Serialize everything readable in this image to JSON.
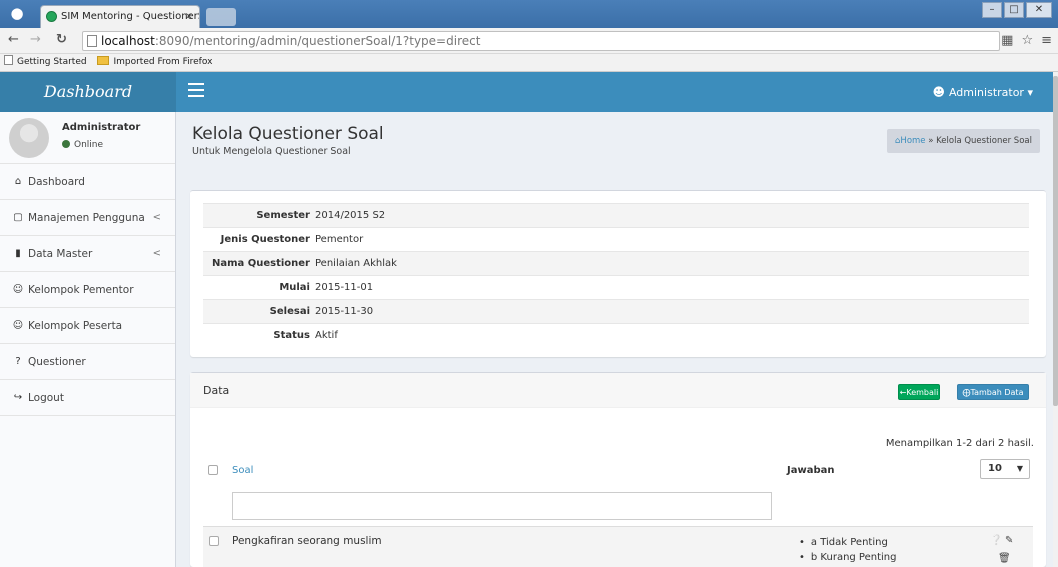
{
  "browser": {
    "tab_title": "SIM Mentoring - QuestionerS",
    "url_host": "localhost",
    "url_path": ":8090/mentoring/admin/questionerSoal/1?type=direct",
    "bookmarks": [
      "Getting Started",
      "Imported From Firefox"
    ],
    "close_glyph": "×"
  },
  "header": {
    "logo": "Dashboard",
    "user_menu": "Administrator"
  },
  "sidebar": {
    "user_name": "Administrator",
    "status": "Online",
    "items": [
      {
        "label": "Dashboard",
        "icon": "home-icon"
      },
      {
        "label": "Manajemen Pengguna",
        "icon": "lock-icon"
      },
      {
        "label": "Data Master",
        "icon": "book-icon"
      },
      {
        "label": "Kelompok Pementor",
        "icon": "users-icon"
      },
      {
        "label": "Kelompok Peserta",
        "icon": "users-icon"
      },
      {
        "label": "Questioner",
        "icon": "question-icon"
      },
      {
        "label": "Logout",
        "icon": "logout-icon"
      }
    ]
  },
  "page": {
    "title": "Kelola Questioner Soal",
    "subtitle": "Untuk Mengelola Questioner Soal",
    "breadcrumb_home": "Home",
    "breadcrumb_sep": " » ",
    "breadcrumb_current": "Kelola Questioner Soal"
  },
  "detail": [
    {
      "label": "Semester",
      "value": "2014/2015 S2"
    },
    {
      "label": "Jenis Questoner",
      "value": "Pementor"
    },
    {
      "label": "Nama Questioner",
      "value": "Penilaian Akhlak"
    },
    {
      "label": "Mulai",
      "value": "2015-11-01"
    },
    {
      "label": "Selesai",
      "value": "2015-11-30"
    },
    {
      "label": "Status",
      "value": "Aktif"
    }
  ],
  "data_box": {
    "title": "Data",
    "back_button": "Kembali",
    "add_button": "Tambah Data",
    "summary": "Menampilkan 1-2 dari 2 hasil.",
    "col_soal": "Soal",
    "col_jawaban": "Jawaban",
    "page_size": "10",
    "rows": [
      {
        "soal": "Pengkafiran seorang muslim",
        "jawaban": [
          "a Tidak Penting",
          "b Kurang Penting"
        ]
      }
    ]
  },
  "colors": {
    "header": "#3c8dbc",
    "logo_bg": "#367fa9",
    "success": "#00a65a",
    "online": "#3c763d"
  }
}
